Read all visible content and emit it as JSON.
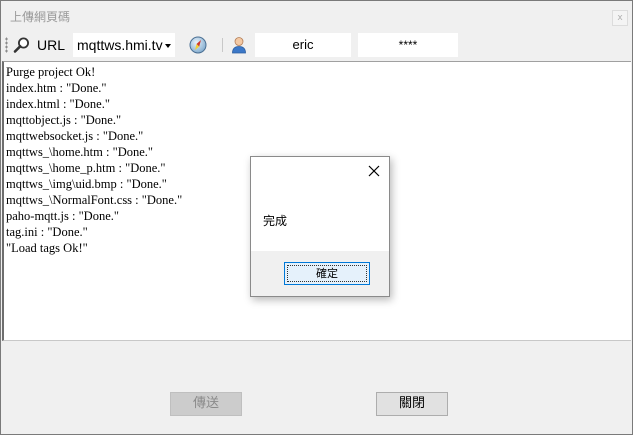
{
  "window": {
    "title": "上傳網頁碼",
    "close_glyph": "x"
  },
  "toolbar": {
    "search_icon": "magnifier-icon",
    "url_label": "URL",
    "host_value": "mqttws.hmi.tv",
    "connect_icon": "compass-icon",
    "user_icon": "user-icon",
    "username": "eric",
    "password_mask": "****"
  },
  "log": {
    "lines": [
      "Purge project Ok!",
      "index.htm : \"Done.\"",
      "index.html : \"Done.\"",
      "mqttobject.js : \"Done.\"",
      "mqttwebsocket.js : \"Done.\"",
      "mqttws_\\home.htm : \"Done.\"",
      "mqttws_\\home_p.htm : \"Done.\"",
      "mqttws_\\img\\uid.bmp : \"Done.\"",
      "mqttws_\\NormalFont.css : \"Done.\"",
      "paho-mqtt.js : \"Done.\"",
      "tag.ini : \"Done.\"",
      "\"Load tags Ok!\""
    ]
  },
  "buttons": {
    "send_label": "傳送",
    "close_label": "關閉"
  },
  "dialog": {
    "message": "完成",
    "ok_label": "確定"
  },
  "colors": {
    "accent": "#0078d7",
    "window_bg": "#f0f0f0"
  }
}
